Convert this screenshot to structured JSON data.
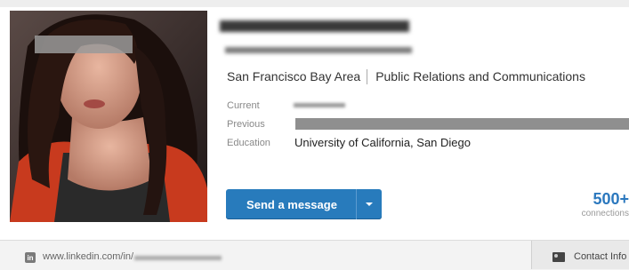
{
  "profile": {
    "location": "San Francisco Bay Area",
    "industry": "Public Relations and Communications",
    "labels": {
      "current": "Current",
      "previous": "Previous",
      "education": "Education"
    },
    "education_value": "University of California, San Diego"
  },
  "actions": {
    "send_message_label": "Send a message",
    "dropdown_icon": "caret-down-icon"
  },
  "connections": {
    "count": "500+",
    "label": "connections"
  },
  "footer": {
    "profile_url": "www.linkedin.com/in/",
    "contact_info_label": "Contact Info",
    "linkedin_icon": "linkedin-icon",
    "contact_icon": "contact-card-icon"
  },
  "colors": {
    "button_blue": "#287bbc",
    "connections_blue": "#2b78be"
  }
}
